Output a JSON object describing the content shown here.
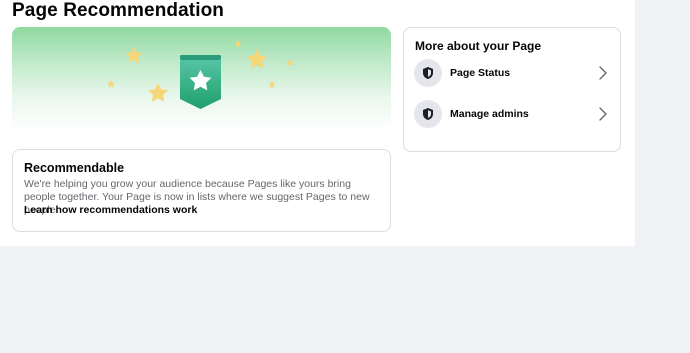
{
  "page": {
    "title": "Page Recommendation"
  },
  "recommendable": {
    "title": "Recommendable",
    "description": "We're helping you grow your audience because Pages like yours bring people together. Your Page is now in lists where we suggest Pages to new people.",
    "link": "Learn how recommendations work"
  },
  "more": {
    "title": "More about your Page",
    "items": [
      {
        "label": "Page Status",
        "icon": "shield-icon"
      },
      {
        "label": "Manage admins",
        "icon": "shield-icon"
      }
    ]
  },
  "colors": {
    "accent_green": "#2fb67c",
    "star_yellow": "#f5d77a"
  }
}
